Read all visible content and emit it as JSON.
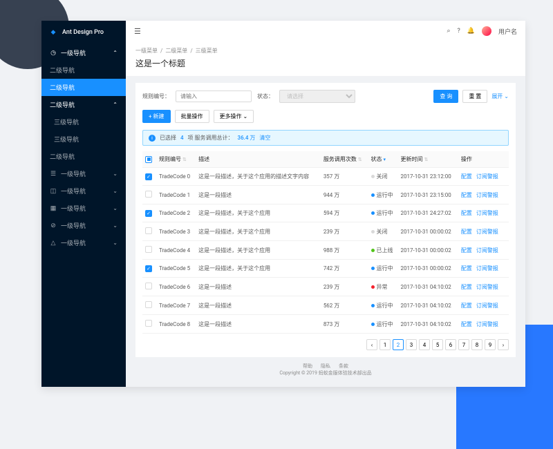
{
  "brand": "Ant Design Pro",
  "topbar": {
    "username": "用户名"
  },
  "breadcrumbs": [
    "一级菜单",
    "二级菜单",
    "三级菜单"
  ],
  "page_title": "这是一个标题",
  "sidebar": {
    "items": [
      {
        "label": "一级导航",
        "icon": "◷",
        "open": true,
        "children": [
          {
            "label": "二级导航"
          },
          {
            "label": "二级导航",
            "selected": true
          },
          {
            "label": "二级导航",
            "open": true,
            "children": [
              {
                "label": "三级导航"
              },
              {
                "label": "三级导航"
              }
            ]
          },
          {
            "label": "二级导航"
          }
        ]
      },
      {
        "label": "一级导航",
        "icon": "☰"
      },
      {
        "label": "一级导航",
        "icon": "◫"
      },
      {
        "label": "一级导航",
        "icon": "▦"
      },
      {
        "label": "一级导航",
        "icon": "⊘"
      },
      {
        "label": "一级导航",
        "icon": "△"
      }
    ]
  },
  "filters": {
    "code_label": "规则编号：",
    "code_placeholder": "请输入",
    "status_label": "状态：",
    "status_placeholder": "请选择",
    "query": "查 询",
    "reset": "重 置",
    "expand": "展开"
  },
  "toolbar": {
    "new": "+ 新建",
    "bulk": "批量操作",
    "more": "更多操作"
  },
  "alert": {
    "prefix": "已选择",
    "count": "4",
    "mid": "项  服务调用总计：",
    "total": "36.4 万",
    "clear": "清空"
  },
  "columns": {
    "code": "规则编号",
    "desc": "描述",
    "calls": "服务调用次数",
    "status": "状态",
    "updated": "更新时间",
    "ops": "操作"
  },
  "status_map": {
    "closed": "关闭",
    "running": "运行中",
    "online": "已上线",
    "error": "异常"
  },
  "ops": {
    "config": "配置",
    "sub": "订阅警报"
  },
  "rows": [
    {
      "check": true,
      "code": "TradeCode 0",
      "desc": "这是一段描述，关于这个应用的描述文字内容",
      "calls": "357 万",
      "status": "closed",
      "dot": "grey",
      "updated": "2017-10-31 23:12:00"
    },
    {
      "check": false,
      "code": "TradeCode 1",
      "desc": "这是一段描述",
      "calls": "944 万",
      "status": "running",
      "dot": "blue",
      "updated": "2017-10-31 23:15:00"
    },
    {
      "check": true,
      "code": "TradeCode 2",
      "desc": "这是一段描述，关于这个应用",
      "calls": "594 万",
      "status": "running",
      "dot": "blue",
      "updated": "2017-10-31 24:27:02"
    },
    {
      "check": false,
      "code": "TradeCode 3",
      "desc": "这是一段描述，关于这个应用",
      "calls": "239 万",
      "status": "closed",
      "dot": "grey",
      "updated": "2017-10-31 00:00:02"
    },
    {
      "check": false,
      "code": "TradeCode 4",
      "desc": "这是一段描述，关于这个应用",
      "calls": "988 万",
      "status": "online",
      "dot": "green",
      "updated": "2017-10-31 00:00:02"
    },
    {
      "check": true,
      "code": "TradeCode 5",
      "desc": "这是一段描述，关于这个应用",
      "calls": "742 万",
      "status": "running",
      "dot": "blue",
      "updated": "2017-10-31 00:00:02"
    },
    {
      "check": false,
      "code": "TradeCode 6",
      "desc": "这是一段描述",
      "calls": "239 万",
      "status": "error",
      "dot": "red",
      "updated": "2017-10-31 04:10:02"
    },
    {
      "check": false,
      "code": "TradeCode 7",
      "desc": "这是一段描述",
      "calls": "562 万",
      "status": "running",
      "dot": "blue",
      "updated": "2017-10-31 04:10:02"
    },
    {
      "check": false,
      "code": "TradeCode 8",
      "desc": "这是一段描述",
      "calls": "873 万",
      "status": "running",
      "dot": "blue",
      "updated": "2017-10-31 04:10:02"
    }
  ],
  "pager": {
    "pages": [
      "1",
      "2",
      "3",
      "4",
      "5",
      "6",
      "7",
      "8",
      "9"
    ],
    "active": 2
  },
  "footer": {
    "links": [
      "帮助",
      "隐私",
      "条款"
    ],
    "copyright": "Copyright © 2019 蚂蚁金服体验技术部出品"
  }
}
